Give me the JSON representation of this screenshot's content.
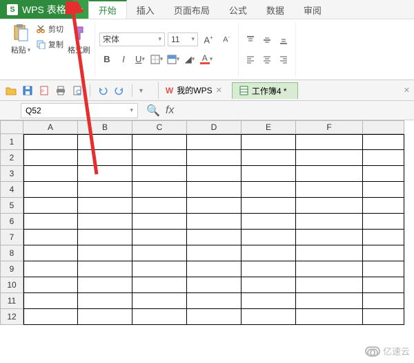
{
  "app": {
    "name": "WPS 表格"
  },
  "menu": {
    "tabs": [
      "开始",
      "插入",
      "页面布局",
      "公式",
      "数据",
      "审阅"
    ],
    "active": 0
  },
  "ribbon": {
    "paste": "粘贴",
    "cut": "剪切",
    "copy": "复制",
    "format_painter": "格式刷",
    "font_name": "宋体",
    "font_size": "11",
    "bold": "B",
    "italic": "I",
    "underline": "U"
  },
  "doc_tabs": {
    "tab1": "我的WPS",
    "tab2": "工作簿4 *"
  },
  "formula": {
    "cell_ref": "Q52",
    "fx": "fx"
  },
  "grid": {
    "cols": [
      "A",
      "B",
      "C",
      "D",
      "E",
      "F"
    ],
    "rows": [
      "1",
      "2",
      "3",
      "4",
      "5",
      "6",
      "7",
      "8",
      "9",
      "10",
      "11",
      "12"
    ]
  },
  "watermark": "亿速云"
}
